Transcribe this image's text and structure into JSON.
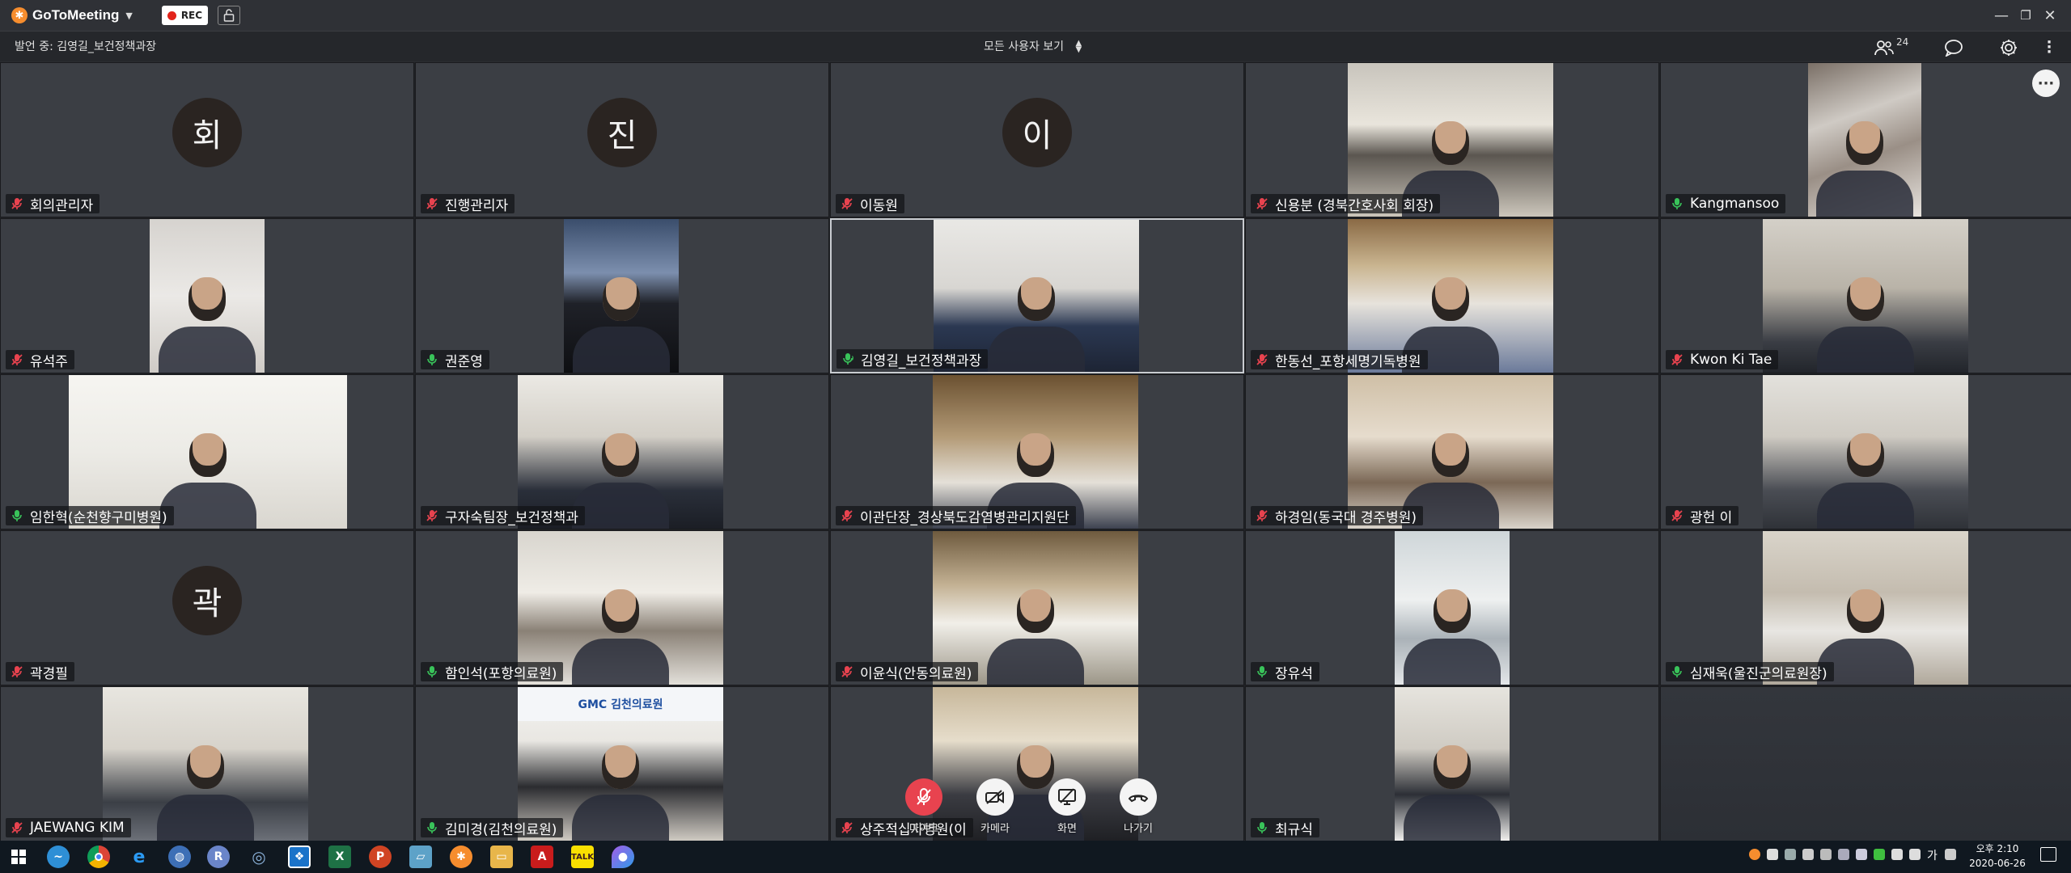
{
  "app": {
    "brand": "GoToMeeting",
    "rec_label": "REC",
    "brand_color": "#f68d2e"
  },
  "infobar": {
    "speaking": "발언 중: 김영길_보건정책과장",
    "view_mode": "모든 사용자 보기",
    "participant_count": "24"
  },
  "participants": [
    {
      "name": "회의관리자",
      "mic": "muted",
      "avatar": "회",
      "video": "none"
    },
    {
      "name": "진행관리자",
      "mic": "muted",
      "avatar": "진",
      "video": "none"
    },
    {
      "name": "이동원",
      "mic": "muted",
      "avatar": "이",
      "video": "none"
    },
    {
      "name": "신용분 (경북간호사회 회장)",
      "mic": "muted",
      "video": "camera"
    },
    {
      "name": "Kangmansoo",
      "mic": "on",
      "video": "camera"
    },
    {
      "name": "유석주",
      "mic": "muted",
      "video": "camera"
    },
    {
      "name": "권준영",
      "mic": "on",
      "video": "camera"
    },
    {
      "name": "김영길_보건정책과장",
      "mic": "speaking",
      "video": "camera",
      "active": true
    },
    {
      "name": "한동선_포항세명기독병원",
      "mic": "muted",
      "video": "camera"
    },
    {
      "name": "Kwon Ki Tae",
      "mic": "muted",
      "video": "camera"
    },
    {
      "name": "임한혁(순천향구미병원)",
      "mic": "on",
      "video": "camera"
    },
    {
      "name": "구자숙팀장_보건정책과",
      "mic": "muted",
      "video": "camera"
    },
    {
      "name": "이관단장_경상북도감염병관리지원단",
      "mic": "muted",
      "video": "camera"
    },
    {
      "name": "하경임(동국대 경주병원)",
      "mic": "muted",
      "video": "camera"
    },
    {
      "name": "광헌 이",
      "mic": "muted",
      "video": "camera"
    },
    {
      "name": "곽경필",
      "mic": "muted",
      "avatar": "곽",
      "video": "none"
    },
    {
      "name": "함인석(포항의료원)",
      "mic": "on",
      "video": "camera"
    },
    {
      "name": "이윤식(안동의료원)",
      "mic": "muted",
      "video": "camera"
    },
    {
      "name": "장유석",
      "mic": "on",
      "video": "camera"
    },
    {
      "name": "심재욱(울진군의료원장)",
      "mic": "on",
      "video": "camera"
    },
    {
      "name": "JAEWANG KIM",
      "mic": "muted",
      "video": "camera"
    },
    {
      "name": "김미경(김천의료원)",
      "mic": "on",
      "video": "camera"
    },
    {
      "name": "상주적십자병원(이",
      "mic": "muted",
      "video": "camera"
    },
    {
      "name": "최규식",
      "mic": "on",
      "video": "camera"
    }
  ],
  "video_signage": {
    "kimcheon_logo": "GMC 김천의료원"
  },
  "controls": {
    "mic_label": "마이크",
    "camera_label": "카메라",
    "screen_label": "화면",
    "leave_label": "나가기",
    "mic_color": "#e8434f"
  },
  "taskbar": {
    "time": "오후 2:10",
    "date": "2020-06-26",
    "ime": "가"
  }
}
